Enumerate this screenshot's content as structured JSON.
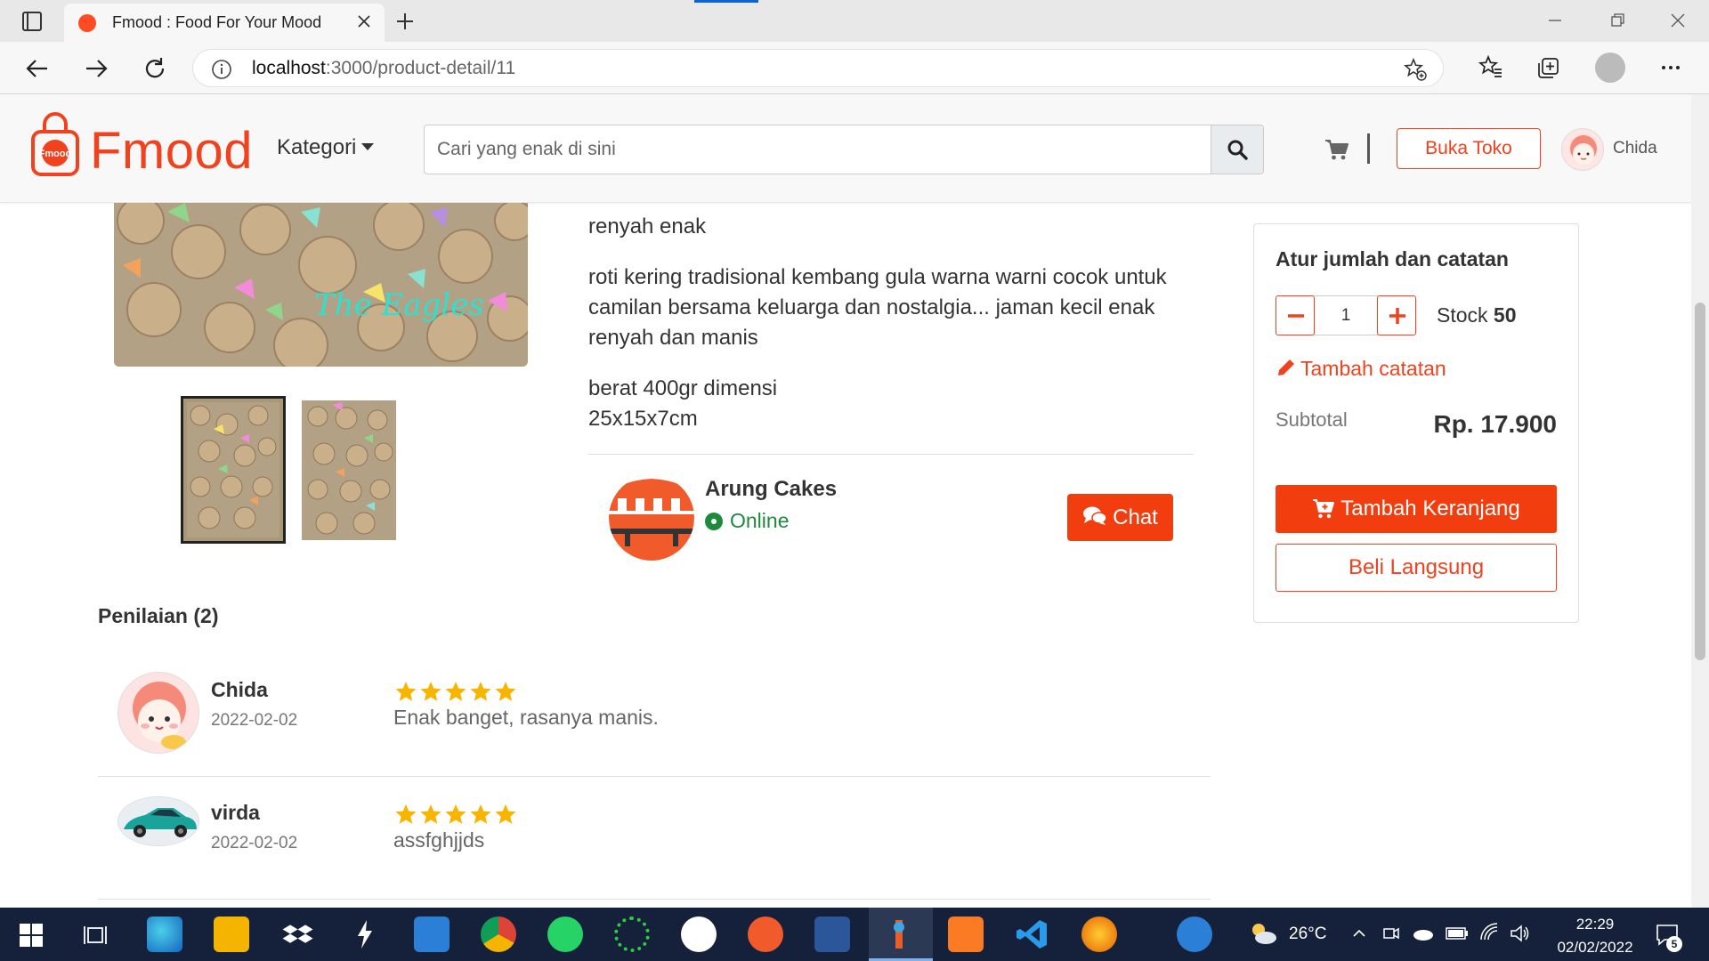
{
  "browser": {
    "tab_title": "Fmood : Food For Your Mood",
    "url_host": "localhost",
    "url_path": ":3000/product-detail/11"
  },
  "header": {
    "brand": "Fmood",
    "kategori_label": "Kategori",
    "search_placeholder": "Cari yang enak di sini",
    "open_shop_label": "Buka Toko",
    "user_name": "Chida"
  },
  "product": {
    "image_watermark": "The Eagles",
    "description": [
      "renyah enak",
      "roti kering tradisional kembang gula warna warni cocok untuk camilan bersama keluarga dan nostalgia... jaman kecil enak renyah dan manis",
      "berat 400gr dimensi 25x15x7cm"
    ]
  },
  "shop": {
    "name": "Arung Cakes",
    "status": "Online",
    "chat_label": "Chat"
  },
  "purchase_card": {
    "heading": "Atur jumlah dan catatan",
    "quantity": "1",
    "stock_label": "Stock",
    "stock_value": "50",
    "note_label": "Tambah catatan",
    "subtotal_label": "Subtotal",
    "subtotal_value": "Rp. 17.900",
    "add_to_cart_label": "Tambah Keranjang",
    "buy_now_label": "Beli Langsung"
  },
  "reviews": {
    "heading": "Penilaian (2)",
    "items": [
      {
        "name": "Chida",
        "date": "2022-02-02",
        "rating": 5,
        "text": "Enak banget, rasanya manis."
      },
      {
        "name": "virda",
        "date": "2022-02-02",
        "rating": 5,
        "text": "assfghjjds"
      }
    ]
  },
  "taskbar": {
    "temperature": "26°C",
    "time": "22:29",
    "date": "02/02/2022",
    "notification_count": "5"
  },
  "colors": {
    "brand": "#f0421e",
    "button": "#f23d0e",
    "online": "#1e8a3c",
    "star": "#f7b500"
  }
}
